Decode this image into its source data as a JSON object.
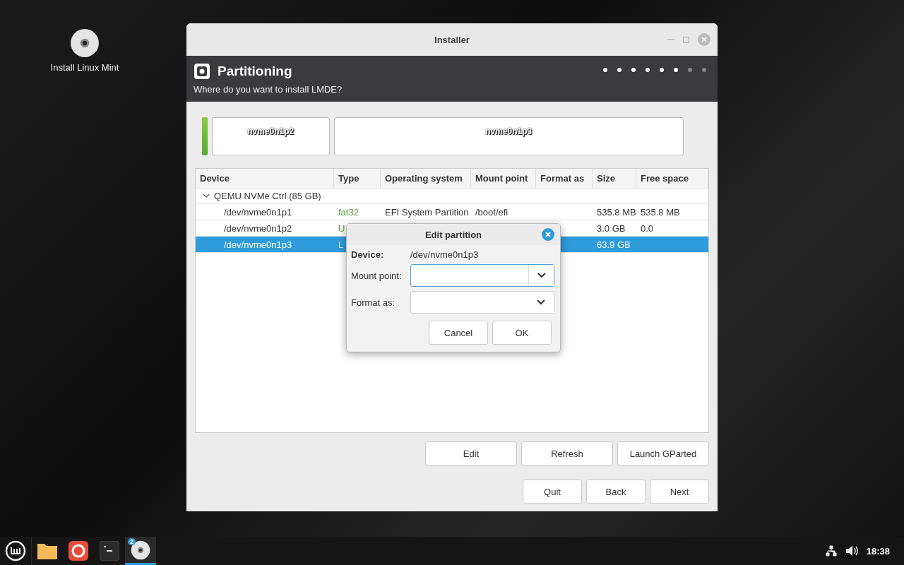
{
  "desktop": {
    "icons": [
      {
        "label": "Install Linux Mint"
      }
    ]
  },
  "window": {
    "title": "Installer",
    "header": {
      "title": "Partitioning",
      "subtitle": "Where do you want to install LMDE?"
    },
    "steps": [
      {
        "done": true
      },
      {
        "done": true
      },
      {
        "done": true
      },
      {
        "done": true
      },
      {
        "done": true
      },
      {
        "done": true
      },
      {
        "done": false
      },
      {
        "done": false
      }
    ],
    "partition_bar": [
      {
        "kind": "small"
      },
      {
        "kind": "part",
        "label": "nvme0n1p2"
      },
      {
        "kind": "part",
        "label": "nvme0n1p3"
      }
    ],
    "table": {
      "columns": [
        "Device",
        "Type",
        "Operating system",
        "Mount point",
        "Format as",
        "Size",
        "Free space"
      ],
      "disks": [
        {
          "name": "QEMU NVMe Ctrl (85 GB)",
          "expanded": true,
          "children": [
            {
              "device": "/dev/nvme0n1p1",
              "type": "fat32",
              "os": "EFI System Partition",
              "mount": "/boot/efi",
              "size": "535.8 MB",
              "free": "535.8 MB",
              "selected": false
            },
            {
              "device": "/dev/nvme0n1p2",
              "type": "U",
              "size": "3.0 GB",
              "free": "0.0",
              "selected": false
            },
            {
              "device": "/dev/nvme0n1p3",
              "type": "L",
              "size": "63.9 GB",
              "selected": true
            }
          ]
        }
      ]
    },
    "actions": [
      "Edit",
      "Refresh",
      "Launch GParted"
    ],
    "nav": [
      "Quit",
      "Back",
      "Next"
    ]
  },
  "dialog": {
    "title": "Edit partition",
    "device_label": "Device:",
    "device": "/dev/nvme0n1p3",
    "mount_label": "Mount point:",
    "format_label": "Format as:",
    "buttons": [
      "Cancel",
      "OK"
    ]
  },
  "taskbar": {
    "apps": [
      {
        "kind": "files"
      },
      {
        "kind": "browser"
      },
      {
        "kind": "terminal"
      },
      {
        "kind": "disc",
        "badge": "2"
      }
    ],
    "clock": "18:38"
  }
}
